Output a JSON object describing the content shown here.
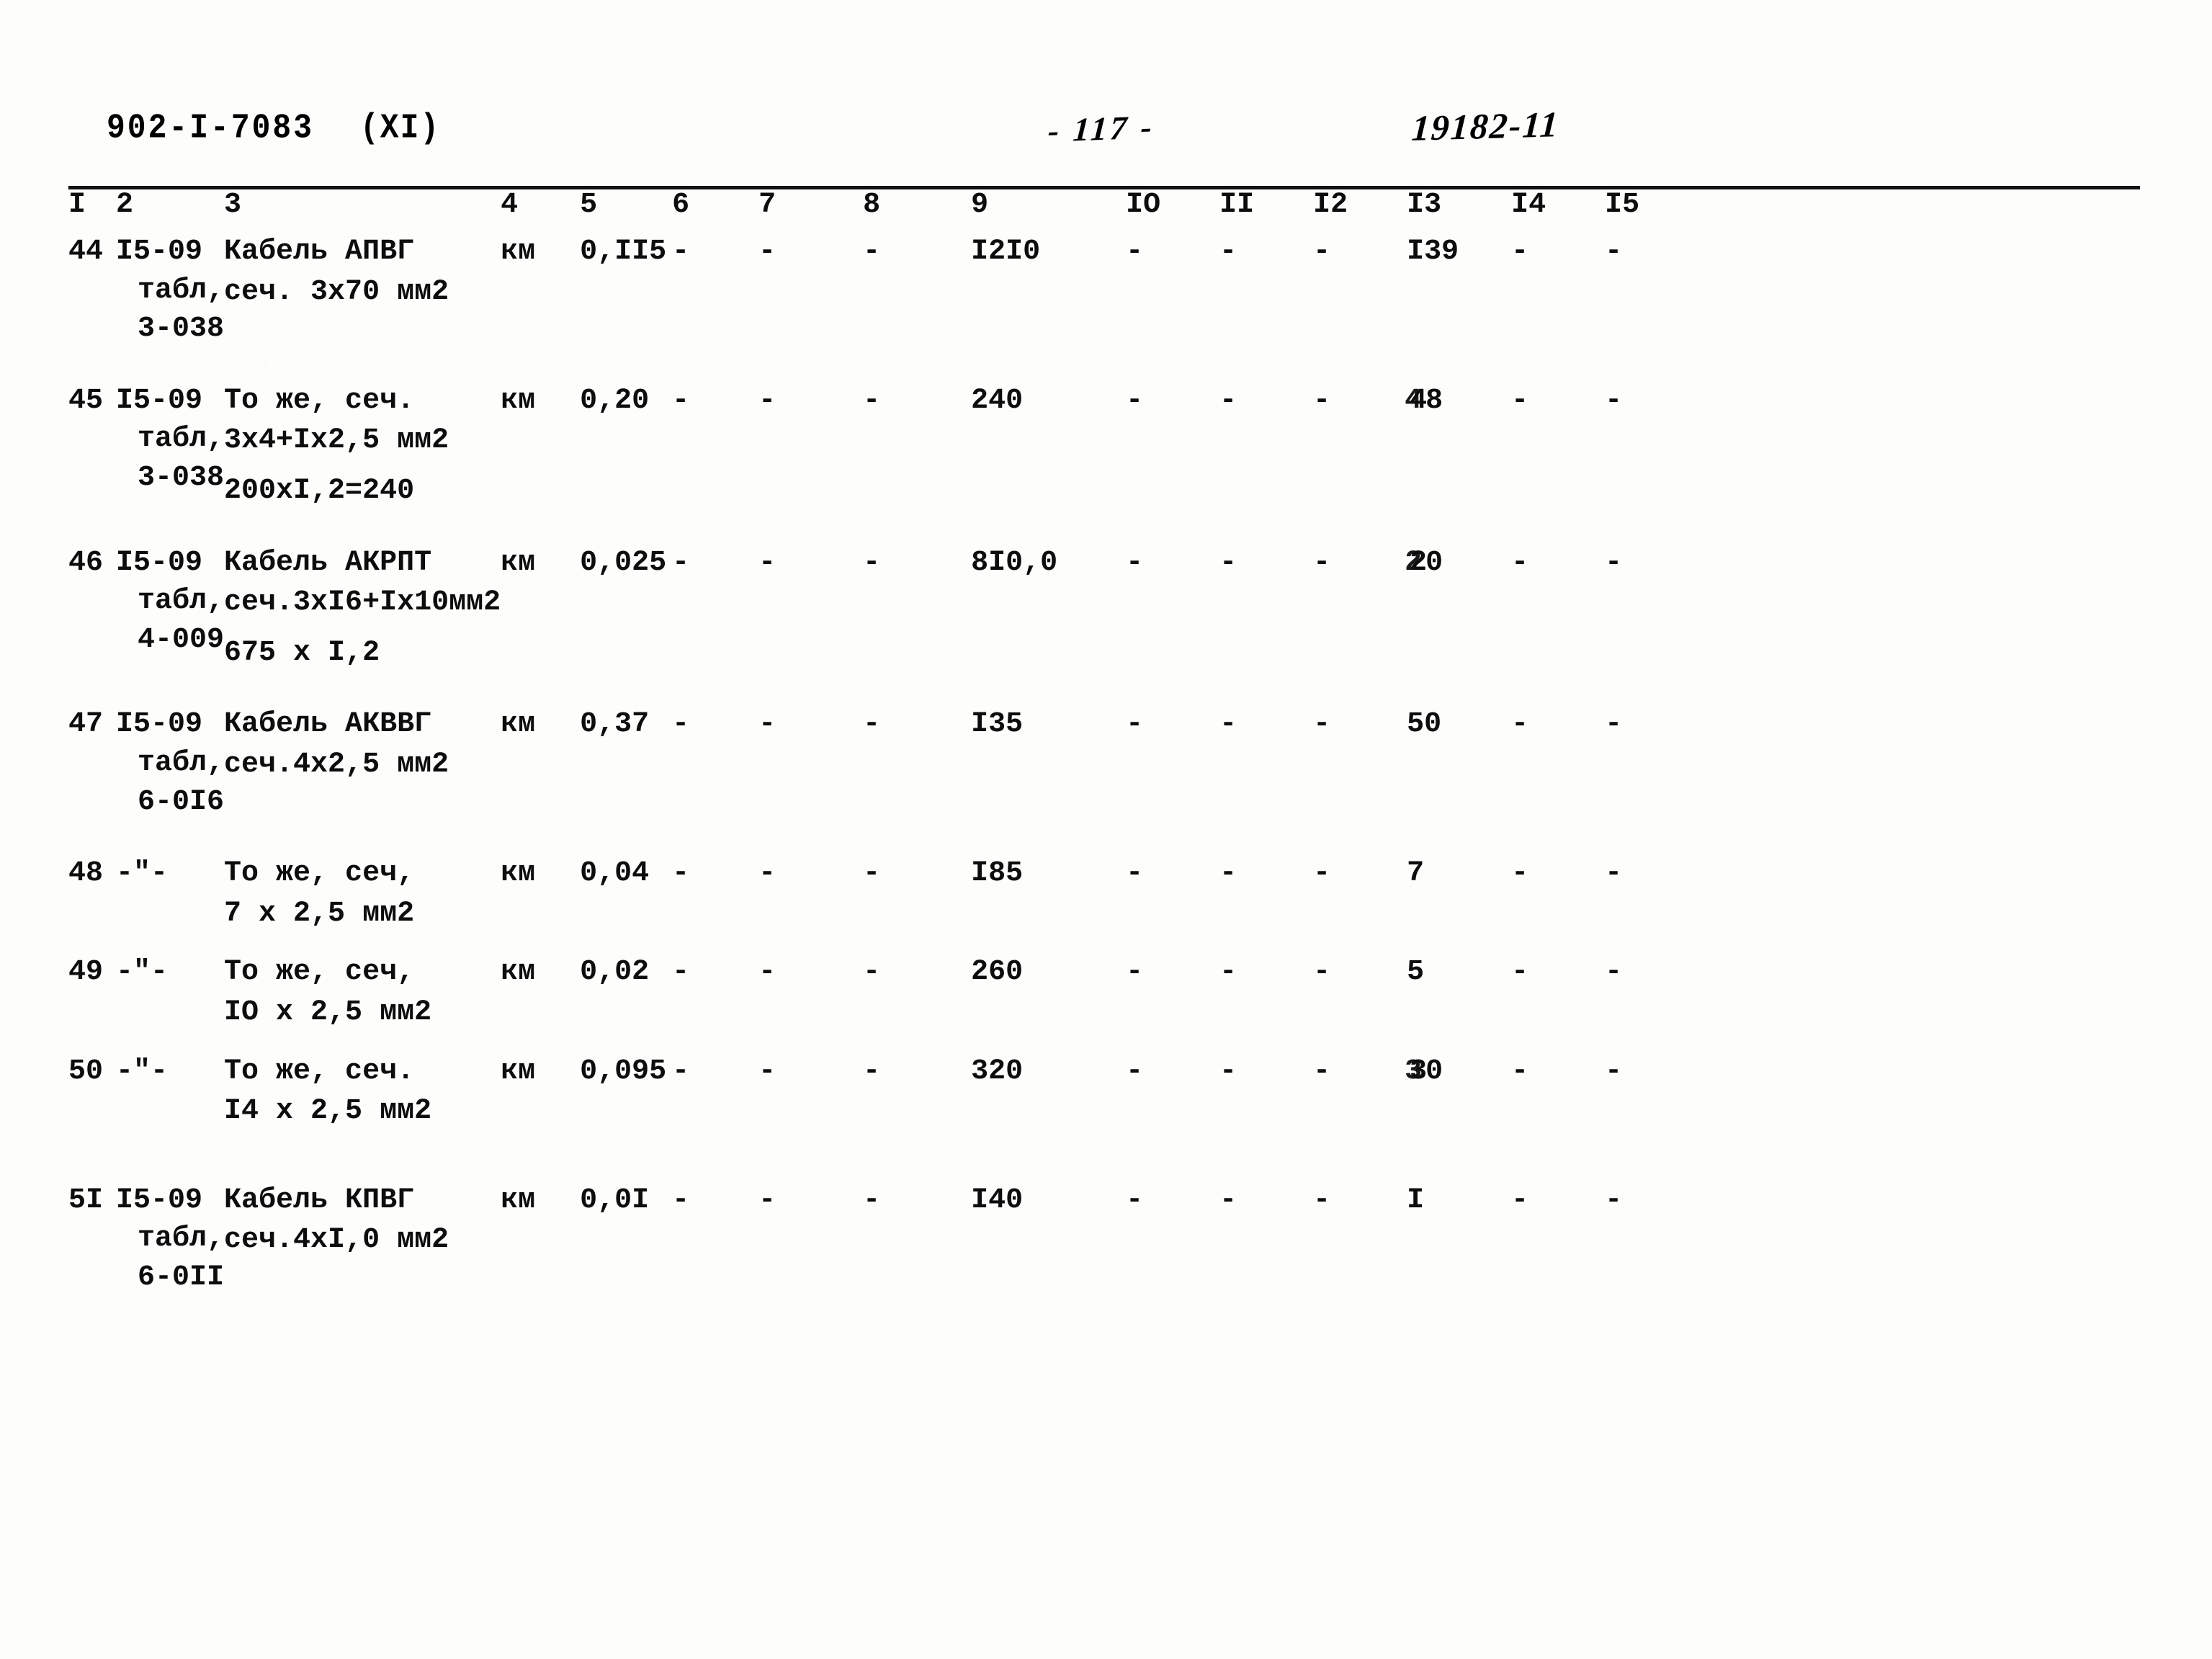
{
  "header": {
    "doc_code": "902-I-7083",
    "doc_section": "(XI)",
    "page_number": "- 117 -",
    "doc_ref": "19182-11"
  },
  "table": {
    "column_numbers": [
      "I",
      "2",
      "3",
      "4",
      "5",
      "6",
      "7",
      "8",
      "9",
      "IO",
      "II",
      "I2",
      "I3",
      "I4",
      "I5"
    ],
    "rows": [
      {
        "num": "44",
        "code": [
          "I5-09",
          "табл,",
          "3-038"
        ],
        "desc": [
          "Кабель АПВГ",
          "сеч. 3х70 мм2"
        ],
        "unit": "км",
        "c5": "0,II5",
        "c6": "-",
        "c7": "-",
        "c8": "-",
        "c9": "I2I0",
        "c10": "-",
        "c11": "-",
        "c12": "-",
        "c13": "I39",
        "c13_over": "",
        "c14": "-",
        "c15": "-"
      },
      {
        "num": "45",
        "code": [
          "I5-09",
          "табл,",
          "3-038"
        ],
        "desc": [
          "То же, сеч.",
          "3х4+Iх2,5 мм2",
          "200хI,2=240"
        ],
        "unit": "км",
        "c5": "0,20",
        "c6": "-",
        "c7": "-",
        "c8": "-",
        "c9": "240",
        "c10": "-",
        "c11": "-",
        "c12": "-",
        "c13": "48",
        "c13_over": "4",
        "c14": "-",
        "c15": "-"
      },
      {
        "num": "46",
        "code": [
          "I5-09",
          "табл,",
          "4-009"
        ],
        "desc": [
          "Кабель АКРПТ",
          "сеч.3хI6+Iх10мм2",
          "675 х I,2"
        ],
        "unit": "км",
        "c5": "0,025",
        "c6": "-",
        "c7": "-",
        "c8": "-",
        "c9": "8I0,0",
        "c10": "-",
        "c11": "-",
        "c12": "-",
        "c13": "20",
        "c13_over": "2",
        "c14": "-",
        "c15": "-"
      },
      {
        "num": "47",
        "code": [
          "I5-09",
          "табл,",
          "6-0I6"
        ],
        "desc": [
          "Кабель АКВВГ",
          "сеч.4х2,5 мм2"
        ],
        "unit": "км",
        "c5": "0,37",
        "c6": "-",
        "c7": "-",
        "c8": "-",
        "c9": "I35",
        "c10": "-",
        "c11": "-",
        "c12": "-",
        "c13": "50",
        "c13_over": "",
        "c14": "-",
        "c15": "-"
      },
      {
        "num": "48",
        "code": [
          "-\"-"
        ],
        "desc": [
          "То же, сеч,",
          "7 х 2,5 мм2"
        ],
        "unit": "км",
        "c5": "0,04",
        "c6": "-",
        "c7": "-",
        "c8": "-",
        "c9": "I85",
        "c10": "-",
        "c11": "-",
        "c12": "-",
        "c13": "7",
        "c13_over": "",
        "c14": "-",
        "c15": "-"
      },
      {
        "num": "49",
        "code": [
          "-\"-"
        ],
        "desc": [
          "То же, сеч,",
          "IO х 2,5 мм2"
        ],
        "unit": "км",
        "c5": "0,02",
        "c6": "-",
        "c7": "-",
        "c8": "-",
        "c9": "260",
        "c10": "-",
        "c11": "-",
        "c12": "-",
        "c13": "5",
        "c13_over": "",
        "c14": "-",
        "c15": "-"
      },
      {
        "num": "50",
        "code": [
          "-\"-"
        ],
        "desc": [
          "То же, сеч.",
          "I4 х 2,5 мм2"
        ],
        "unit": "км",
        "c5": "0,095",
        "c6": "-",
        "c7": "-",
        "c8": "-",
        "c9": "320",
        "c10": "-",
        "c11": "-",
        "c12": "-",
        "c13": "30",
        "c13_over": "3",
        "c14": "-",
        "c15": "-"
      },
      {
        "num": "5I",
        "code": [
          "I5-09",
          "табл,",
          "6-0II"
        ],
        "desc": [
          "Кабель КПВГ",
          "сеч.4хI,0 мм2"
        ],
        "unit": "км",
        "c5": "0,0I",
        "c6": "-",
        "c7": "-",
        "c8": "-",
        "c9": "I40",
        "c10": "-",
        "c11": "-",
        "c12": "-",
        "c13": "I",
        "c13_over": "",
        "c14": "-",
        "c15": "-"
      }
    ]
  }
}
